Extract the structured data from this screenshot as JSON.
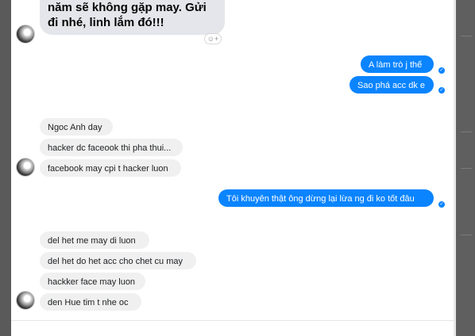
{
  "messages_top": {
    "line1": "năm sẽ không gặp may. Gửi",
    "line2": "đi nhé, linh lắm đó!!!"
  },
  "outgoing": [
    {
      "text": "A làm trò j thế"
    },
    {
      "text": "Sao phá acc dk e"
    },
    {
      "text": "Tôi khuyên thật ông dừng lại lừa ng đi ko tốt đâu"
    }
  ],
  "incoming_group1": [
    {
      "text": "Ngoc Anh day"
    },
    {
      "text": "hacker dc faceook thi pha thui..."
    },
    {
      "text": "facebook may cpi t hacker luon"
    }
  ],
  "incoming_group2": [
    {
      "text": "del het me may di luon"
    },
    {
      "text": "del het do het acc cho chet cu may"
    },
    {
      "text": "hackker face may luon"
    },
    {
      "text": "den Hue tim t nhe oc"
    }
  ],
  "icons": {
    "react": "smiley-plus-icon",
    "seen": "check-circle-icon",
    "avatar": "contact-avatar"
  },
  "colors": {
    "outgoing_bubble": "#0a84ff",
    "incoming_bubble": "#f0f0f0"
  }
}
